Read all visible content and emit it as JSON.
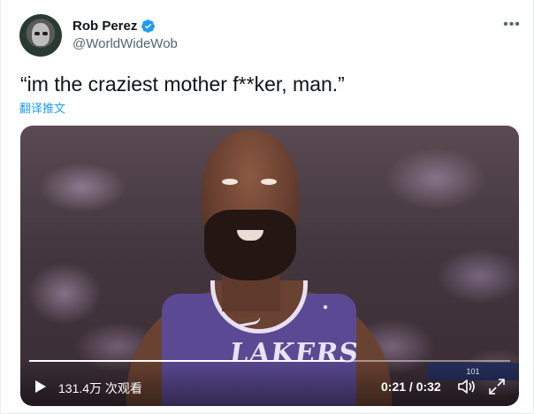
{
  "author": {
    "display_name": "Rob Perez",
    "handle": "@WorldWideWob",
    "verified": true
  },
  "tweet": {
    "text": "“im the craziest mother f**ker, man.”",
    "translate_label": "翻译推文"
  },
  "video": {
    "views_label": "131.4万 次观看",
    "time_label": "0:21 / 0:32",
    "progress": 0.656,
    "jersey_text": "LAKERS",
    "scoreboard": [
      "101"
    ]
  },
  "colors": {
    "accent": "#1d9bf0",
    "jersey": "#5b4a93",
    "text_primary": "#0f1419",
    "text_secondary": "#536471"
  },
  "icons": {
    "more": "more-horizontal-icon",
    "verified": "verified-badge-icon",
    "play": "play-icon",
    "volume": "volume-icon",
    "fullscreen": "fullscreen-icon"
  }
}
